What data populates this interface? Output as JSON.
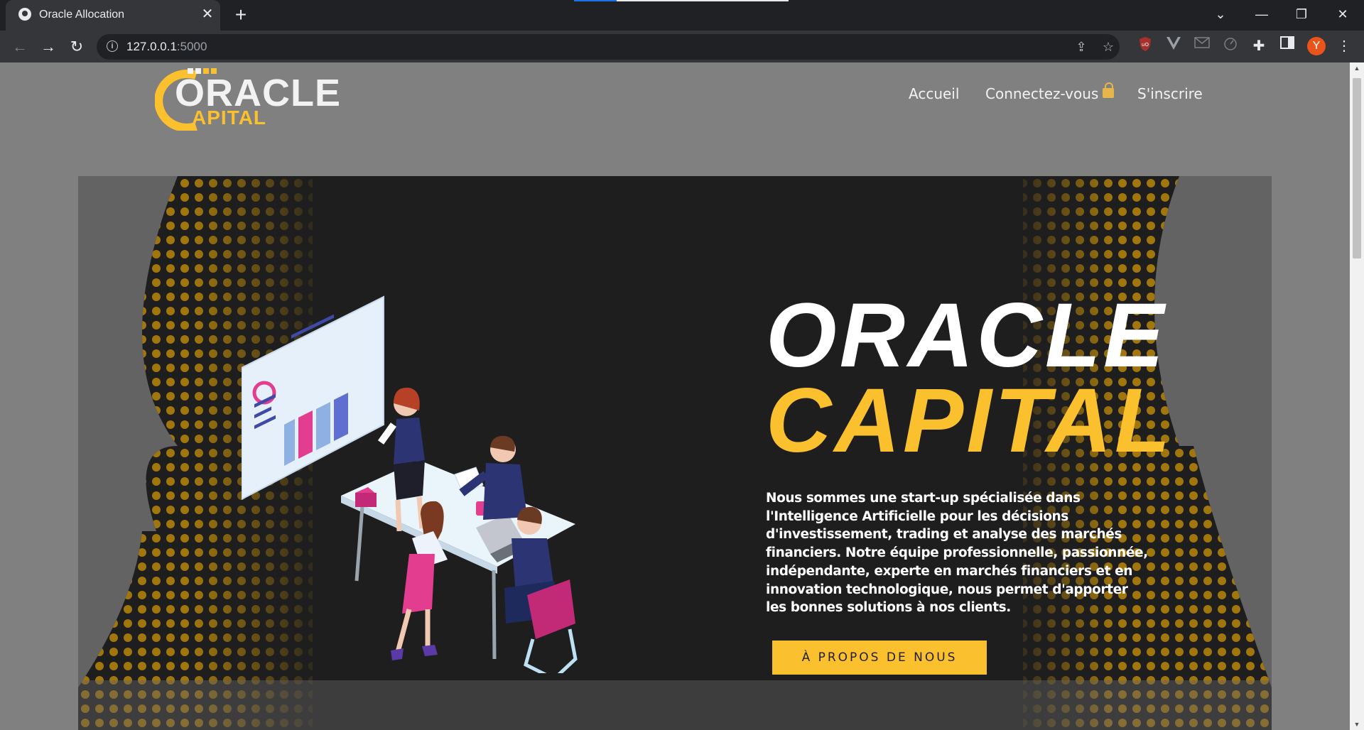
{
  "browser": {
    "tab_title": "Oracle Allocation",
    "url_host": "127.0.0.1",
    "url_port": ":5000",
    "profile_initial": "Y"
  },
  "site": {
    "logo_text_1": "ORACLE",
    "logo_text_2": "APITAL",
    "nav": {
      "home": "Accueil",
      "login": "Connectez-vous",
      "register": "S'inscrire"
    }
  },
  "hero": {
    "title_line1": "ORACLE",
    "title_line2": "CAPITAL",
    "description": "Nous sommes une start-up spécialisée dans l'Intelligence Artificielle pour les décisions d'investissement, trading et analyse des marchés financiers. Notre équipe professionnelle, passionnée, indépendante, experte en marchés financiers et en innovation technologique, nous permet d'apporter les bonnes solutions à nos clients.",
    "button_label": "À PROPOS DE NOUS"
  },
  "colors": {
    "accent": "#fbc02d",
    "hero_background": "#1e1e1e",
    "page_background": "#808080"
  }
}
